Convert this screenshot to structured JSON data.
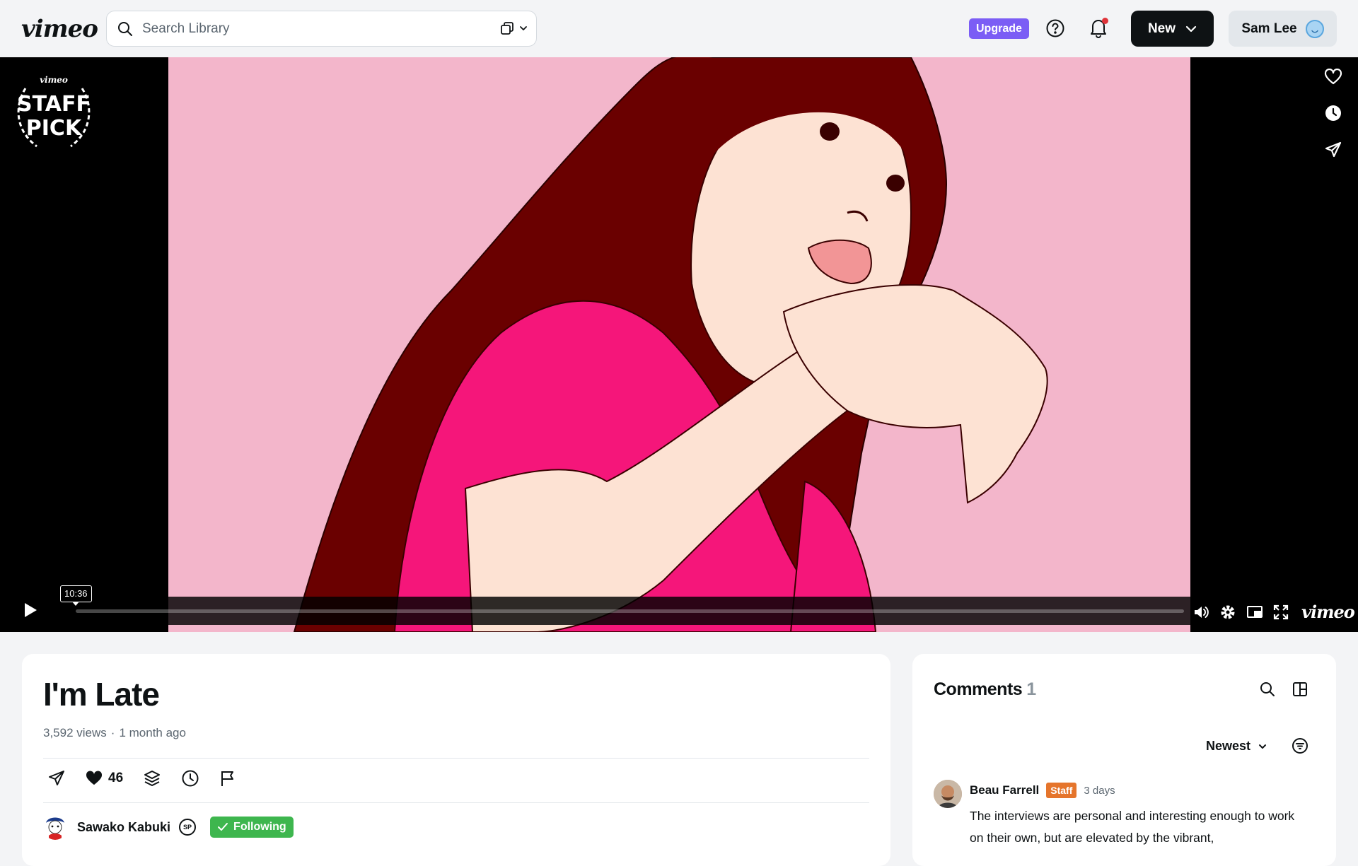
{
  "brand": {
    "logo_text": "vimeo",
    "accent_color": "#7b5df5"
  },
  "header": {
    "search": {
      "placeholder": "Search Library",
      "value": "",
      "icon": "search-icon",
      "filter_icon": "copy-icon"
    },
    "upgrade_label": "Upgrade",
    "help_icon": "help-circle-icon",
    "notifications": {
      "icon": "bell-icon",
      "has_unread": true
    },
    "new_button_label": "New",
    "user": {
      "name": "Sam Lee",
      "avatar_icon": "avatar"
    }
  },
  "player": {
    "badge": {
      "brand": "vimeo",
      "line1": "STAFF",
      "line2": "PICK"
    },
    "side_actions": [
      "heart-icon",
      "clock-icon",
      "send-icon"
    ],
    "duration_tooltip": "10:36",
    "progress_fraction": 0,
    "watermark": "vimeo",
    "controls": [
      "volume-icon",
      "settings-icon",
      "pip-icon",
      "fullscreen-icon"
    ]
  },
  "video": {
    "title": "I'm Late",
    "views": "3,592 views",
    "separator": "·",
    "posted": "1 month ago",
    "likes": "46",
    "creator": {
      "name": "Sawako Kabuki",
      "badge": "SP",
      "follow_label": "Following"
    }
  },
  "comments": {
    "title": "Comments",
    "count": "1",
    "sort_label": "Newest",
    "items": [
      {
        "author": "Beau Farrell",
        "badge": "Staff",
        "time": "3 days",
        "text": "The interviews are personal and interesting enough to work on their own, but are elevated by the vibrant,"
      }
    ]
  },
  "colors": {
    "badge_staff": "#e5752c",
    "following_green": "#3eb64e",
    "notification_dot": "#e0343a"
  }
}
